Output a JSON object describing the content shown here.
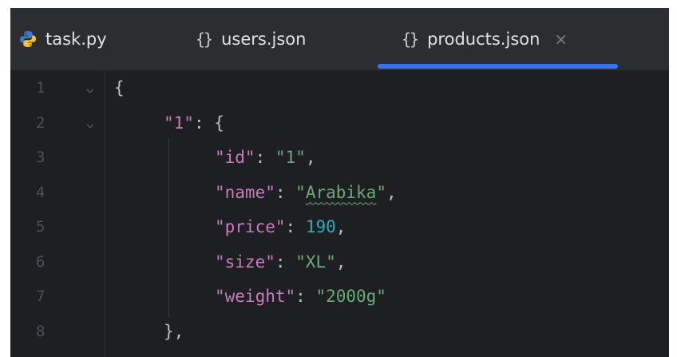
{
  "tabs": [
    {
      "label": "task.py",
      "icon": "python-icon"
    },
    {
      "label": "users.json",
      "icon": "json-braces-icon"
    },
    {
      "label": "products.json",
      "icon": "json-braces-icon",
      "active": true,
      "close_glyph": "×"
    }
  ],
  "json_icon_glyph": "{}",
  "colors": {
    "editor_background": "#1e1f22",
    "tab_bar_background": "#2b2d30",
    "active_tab_indicator": "#3574f0",
    "json_key": "#c77dbb",
    "json_string": "#6aab73",
    "json_number": "#2aacb8",
    "punctuation": "#bcbec4",
    "line_number": "#4b5059"
  },
  "gutter": {
    "line_numbers": [
      "1",
      "2",
      "3",
      "4",
      "5",
      "6",
      "7",
      "8"
    ],
    "fold_glyph": "⌵"
  },
  "code": {
    "line1": {
      "open": "{"
    },
    "line2": {
      "key": "\"1\"",
      "sep": ": ",
      "open": "{"
    },
    "line3": {
      "key": "\"id\"",
      "sep": ": ",
      "value": "\"1\"",
      "end": ","
    },
    "line4": {
      "key": "\"name\"",
      "sep": ": ",
      "q_open": "\"",
      "value": "Arabika",
      "q_close": "\"",
      "end": ","
    },
    "line5": {
      "key": "\"price\"",
      "sep": ": ",
      "value": "190",
      "end": ","
    },
    "line6": {
      "key": "\"size\"",
      "sep": ": ",
      "value": "\"XL\"",
      "end": ","
    },
    "line7": {
      "key": "\"weight\"",
      "sep": ": ",
      "value": "\"2000g\""
    },
    "line8": {
      "close": "},"
    }
  }
}
